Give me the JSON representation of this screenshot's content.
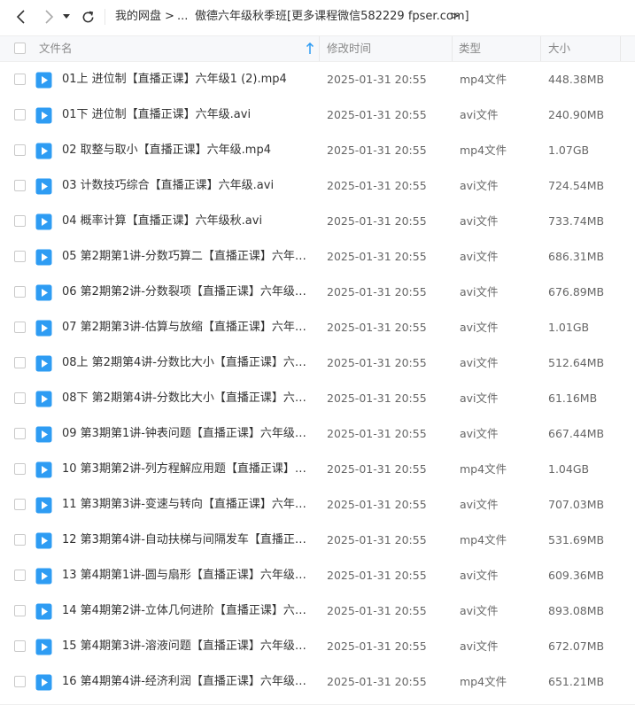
{
  "toolbar": {
    "breadcrumbs": [
      {
        "label": "我的网盘"
      },
      {
        "label": "..."
      },
      {
        "label": "傲德六年级秋季班[更多课程微信582229 fpser.com]"
      }
    ],
    "crumb_separator": ">"
  },
  "header": {
    "name": "文件名",
    "modified": "修改时间",
    "type": "类型",
    "size": "大小"
  },
  "colors": {
    "file_icon": "#2e9cf3",
    "sort_arrow": "#2e9cf3"
  },
  "files": [
    {
      "name": "01上 进位制【直播正课】六年级1 (2).mp4",
      "modified": "2025-01-31 20:55",
      "type": "mp4文件",
      "size": "448.38MB"
    },
    {
      "name": "01下 进位制【直播正课】六年级.avi",
      "modified": "2025-01-31 20:55",
      "type": "avi文件",
      "size": "240.90MB"
    },
    {
      "name": "02 取整与取小【直播正课】六年级.mp4",
      "modified": "2025-01-31 20:55",
      "type": "mp4文件",
      "size": "1.07GB"
    },
    {
      "name": "03 计数技巧综合【直播正课】六年级.avi",
      "modified": "2025-01-31 20:55",
      "type": "avi文件",
      "size": "724.54MB"
    },
    {
      "name": "04 概率计算【直播正课】六年级秋.avi",
      "modified": "2025-01-31 20:55",
      "type": "avi文件",
      "size": "733.74MB"
    },
    {
      "name": "05 第2期第1讲-分数巧算二【直播正课】六年级秋....",
      "modified": "2025-01-31 20:55",
      "type": "avi文件",
      "size": "686.31MB"
    },
    {
      "name": "06 第2期第2讲-分数裂项【直播正课】六年级秋.avi",
      "modified": "2025-01-31 20:55",
      "type": "avi文件",
      "size": "676.89MB"
    },
    {
      "name": "07 第2期第3讲-估算与放缩【直播正课】六年级秋....",
      "modified": "2025-01-31 20:55",
      "type": "avi文件",
      "size": "1.01GB"
    },
    {
      "name": "08上 第2期第4讲-分数比大小【直播正课】六年级...",
      "modified": "2025-01-31 20:55",
      "type": "avi文件",
      "size": "512.64MB"
    },
    {
      "name": "08下 第2期第4讲-分数比大小【直播正课】六年级...",
      "modified": "2025-01-31 20:55",
      "type": "avi文件",
      "size": "61.16MB"
    },
    {
      "name": "09 第3期第1讲-钟表问题【直播正课】六年级秋.avi",
      "modified": "2025-01-31 20:55",
      "type": "avi文件",
      "size": "667.44MB"
    },
    {
      "name": "10 第3期第2讲-列方程解应用题【直播正课】六年...",
      "modified": "2025-01-31 20:55",
      "type": "mp4文件",
      "size": "1.04GB"
    },
    {
      "name": "11 第3期第3讲-变速与转向【直播正课】六年级秋....",
      "modified": "2025-01-31 20:55",
      "type": "avi文件",
      "size": "707.03MB"
    },
    {
      "name": "12 第3期第4讲-自动扶梯与间隔发车【直播正课】...",
      "modified": "2025-01-31 20:55",
      "type": "mp4文件",
      "size": "531.69MB"
    },
    {
      "name": "13 第4期第1讲-圆与扇形【直播正课】六年级秋.avi",
      "modified": "2025-01-31 20:55",
      "type": "avi文件",
      "size": "609.36MB"
    },
    {
      "name": "14 第4期第2讲-立体几何进阶【直播正课】六年级...",
      "modified": "2025-01-31 20:55",
      "type": "avi文件",
      "size": "893.08MB"
    },
    {
      "name": "15 第4期第3讲-溶液问题【直播正课】六年级秋.avi",
      "modified": "2025-01-31 20:55",
      "type": "avi文件",
      "size": "672.07MB"
    },
    {
      "name": "16 第4期第4讲-经济利润【直播正课】六年级秋完...",
      "modified": "2025-01-31 20:55",
      "type": "mp4文件",
      "size": "651.21MB"
    }
  ]
}
